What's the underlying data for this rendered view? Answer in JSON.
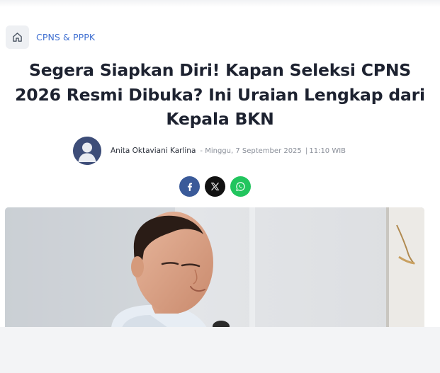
{
  "breadcrumb": {
    "home_icon": "home-icon",
    "category": "CPNS & PPPK"
  },
  "article": {
    "title": "Segera Siapkan Diri! Kapan Seleksi CPNS 2026 Resmi Dibuka? Ini Uraian Lengkap dari Kepala BKN",
    "author": "Anita Oktaviani Karlina",
    "date": "Minggu, 7 September 2025",
    "time": "11:10 WIB",
    "separator_dash": "-",
    "separator_pipe": "|"
  },
  "share": [
    {
      "icon": "facebook-icon",
      "color": "#3a5a99"
    },
    {
      "icon": "x-icon",
      "color": "#111111"
    },
    {
      "icon": "whatsapp-icon",
      "color": "#22c55e"
    }
  ],
  "colors": {
    "accent": "#3f6fd1",
    "title": "#1d2230",
    "meta": "#8b909a"
  }
}
